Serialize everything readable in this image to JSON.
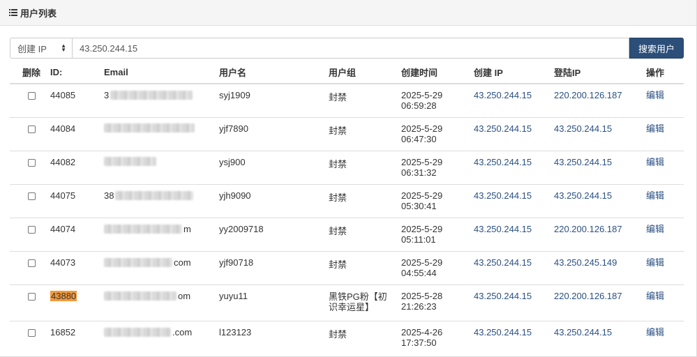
{
  "header": {
    "title": "用户列表",
    "icon": "list-icon"
  },
  "search": {
    "select_value": "创建 IP",
    "input_value": "43.250.244.15",
    "button_label": "搜索用户"
  },
  "table": {
    "columns": [
      "删除",
      "ID:",
      "Email",
      "用户名",
      "用户组",
      "创建时间",
      "创建 IP",
      "登陆IP",
      "操作"
    ],
    "rows": [
      {
        "id": "44085",
        "email_visible": "3",
        "email_suffix": "",
        "username": "syj1909",
        "group": "封禁",
        "date": "2025-5-29",
        "time": "06:59:28",
        "create_ip": "43.250.244.15",
        "login_ip": "220.200.126.187",
        "action": "编辑"
      },
      {
        "id": "44084",
        "email_visible": "",
        "email_suffix": "",
        "username": "yjf7890",
        "group": "封禁",
        "date": "2025-5-29",
        "time": "06:47:30",
        "create_ip": "43.250.244.15",
        "login_ip": "43.250.244.15",
        "action": "编辑"
      },
      {
        "id": "44082",
        "email_visible": "",
        "email_suffix": "",
        "username": "ysj900",
        "group": "封禁",
        "date": "2025-5-29",
        "time": "06:31:32",
        "create_ip": "43.250.244.15",
        "login_ip": "43.250.244.15",
        "action": "编辑"
      },
      {
        "id": "44075",
        "email_visible": "38",
        "email_suffix": "",
        "username": "yjh9090",
        "group": "封禁",
        "date": "2025-5-29",
        "time": "05:30:41",
        "create_ip": "43.250.244.15",
        "login_ip": "43.250.244.15",
        "action": "编辑"
      },
      {
        "id": "44074",
        "email_visible": "",
        "email_suffix": "m",
        "username": "yy2009718",
        "group": "封禁",
        "date": "2025-5-29",
        "time": "05:11:01",
        "create_ip": "43.250.244.15",
        "login_ip": "220.200.126.187",
        "action": "编辑"
      },
      {
        "id": "44073",
        "email_visible": "",
        "email_suffix": "com",
        "username": "yjf90718",
        "group": "封禁",
        "date": "2025-5-29",
        "time": "04:55:44",
        "create_ip": "43.250.244.15",
        "login_ip": "43.250.245.149",
        "action": "编辑"
      },
      {
        "id": "43880",
        "email_visible": "",
        "email_suffix": "om",
        "username": "yuyu11",
        "group": "黑铁PG粉【初识幸运星】",
        "date": "2025-5-28",
        "time": "21:26:23",
        "create_ip": "43.250.244.15",
        "login_ip": "220.200.126.187",
        "action": "编辑"
      },
      {
        "id": "16852",
        "email_visible": "",
        "email_suffix": ".com",
        "username": "l123123",
        "group": "封禁",
        "date": "2025-4-26",
        "time": "17:37:50",
        "create_ip": "43.250.244.15",
        "login_ip": "43.250.244.15",
        "action": "编辑"
      }
    ]
  },
  "colors": {
    "accent": "#2c4f7a",
    "link": "#2a5082",
    "highlight": "#f39a3c"
  }
}
